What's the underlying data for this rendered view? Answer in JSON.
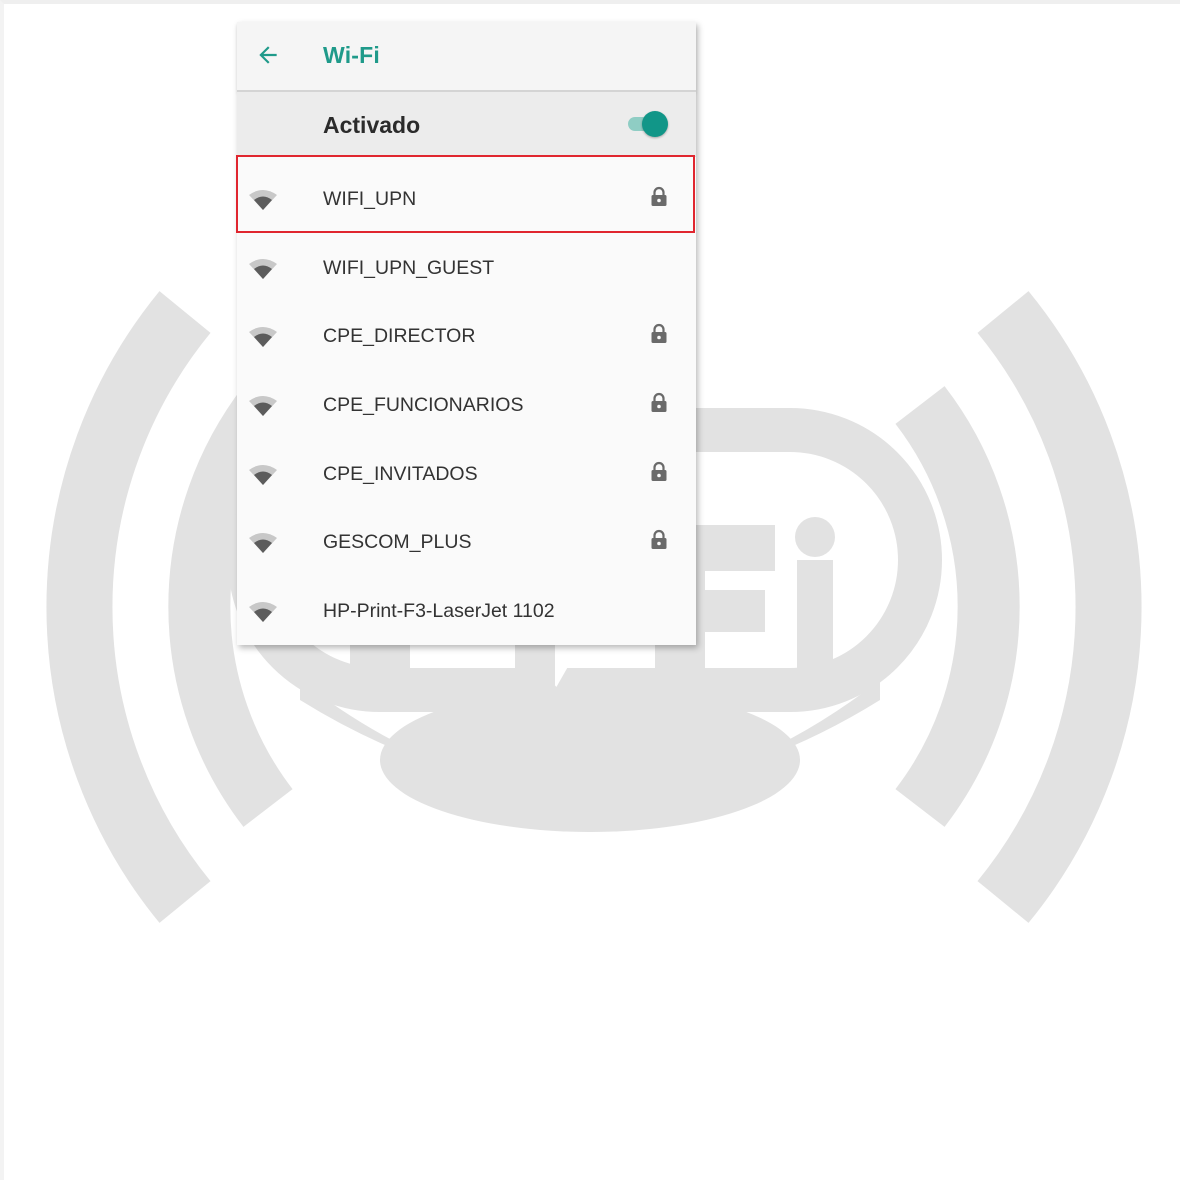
{
  "header": {
    "title": "Wi-Fi",
    "back_icon": "arrow-back-icon"
  },
  "master_switch": {
    "label": "Activado",
    "state": "on",
    "accent_color": "#119688"
  },
  "networks": [
    {
      "name": "WIFI_UPN",
      "secured": true,
      "selected": true
    },
    {
      "name": "WIFI_UPN_GUEST",
      "secured": false,
      "selected": false
    },
    {
      "name": "CPE_DIRECTOR",
      "secured": true,
      "selected": false
    },
    {
      "name": "CPE_FUNCIONARIOS",
      "secured": true,
      "selected": false
    },
    {
      "name": "CPE_INVITADOS",
      "secured": true,
      "selected": false
    },
    {
      "name": "GESCOM_PLUS",
      "secured": true,
      "selected": false
    },
    {
      "name": "HP-Print-F3-LaserJet 1102",
      "secured": false,
      "selected": false
    }
  ],
  "highlight": {
    "color": "#e0262f",
    "target": "WIFI_UPN"
  },
  "background": {
    "logo": "wifi-logo-watermark",
    "logo_color": "#e2e2e2"
  }
}
